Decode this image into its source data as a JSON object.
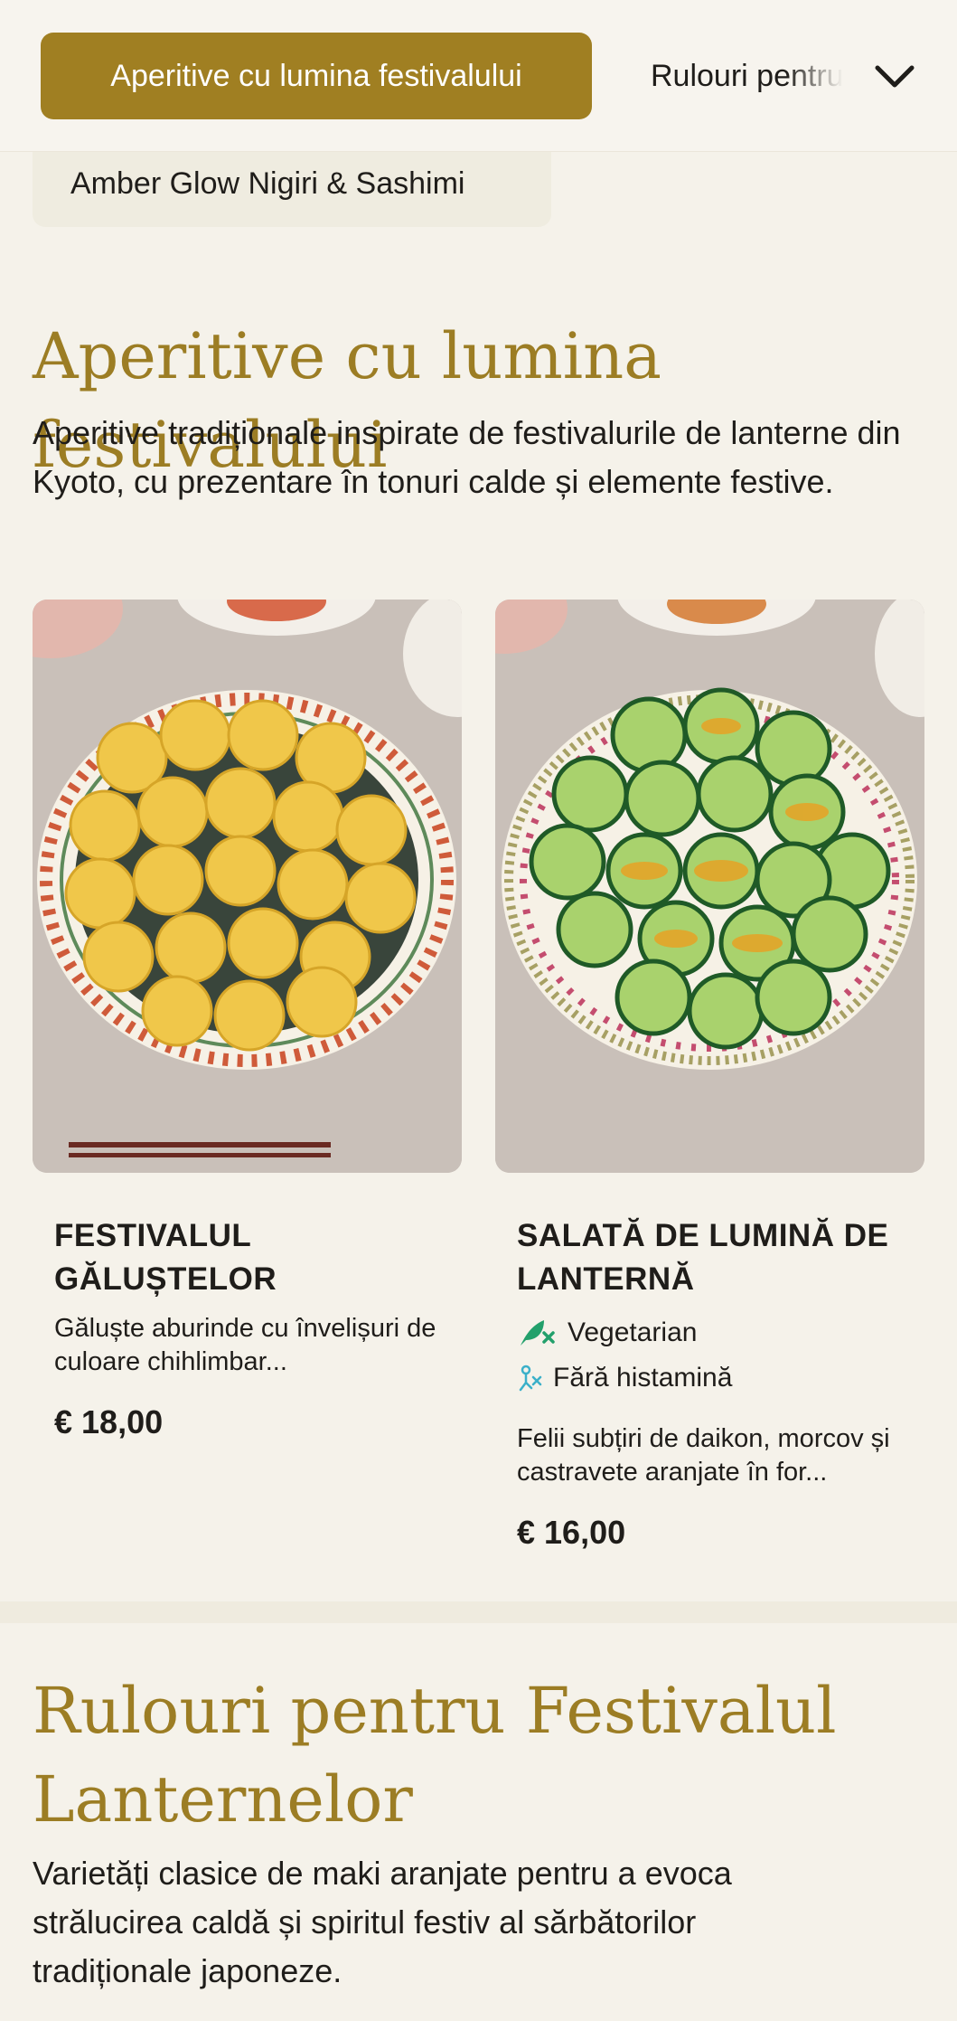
{
  "header": {
    "active_category": "Aperitive cu lumina festivalului",
    "next_category": "Rulouri pentru Festivalul Lanternelor",
    "expand_icon": "chevron-down-icon",
    "subcategory_chip": "Amber Glow Nigiri & Sashimi",
    "accent_color": "#a07f22"
  },
  "section_appetizers": {
    "title": "Aperitive cu lumina festivalului",
    "description": "Aperitive tradiționale inspirate de festivalurile de lanterne din Kyoto, cu prezentare în tonuri calde și elemente festive.",
    "items": [
      {
        "name": "FESTIVALUL GĂLUȘTELOR",
        "description": "Găluște aburinde cu învelișuri de culoare chihlimbar...",
        "price": "€ 18,00"
      },
      {
        "name": "SALATĂ DE LUMINĂ DE LANTERNĂ",
        "tags": [
          {
            "label": "Vegetarian",
            "icon": "leaf-icon",
            "color": "#22a06b"
          },
          {
            "label": "Fără histamină",
            "icon": "histamine-free-icon",
            "color": "#3bb0c9"
          }
        ],
        "description": "Felii subțiri de daikon, morcov și castravete aranjate în for...",
        "price": "€ 16,00"
      }
    ]
  },
  "section_rolls": {
    "title": "Rulouri pentru Festivalul Lanternelor",
    "description": "Varietăți clasice de maki aranjate pentru a evoca strălucirea caldă și spiritul festiv al sărbătorilor tradiționale japoneze."
  }
}
